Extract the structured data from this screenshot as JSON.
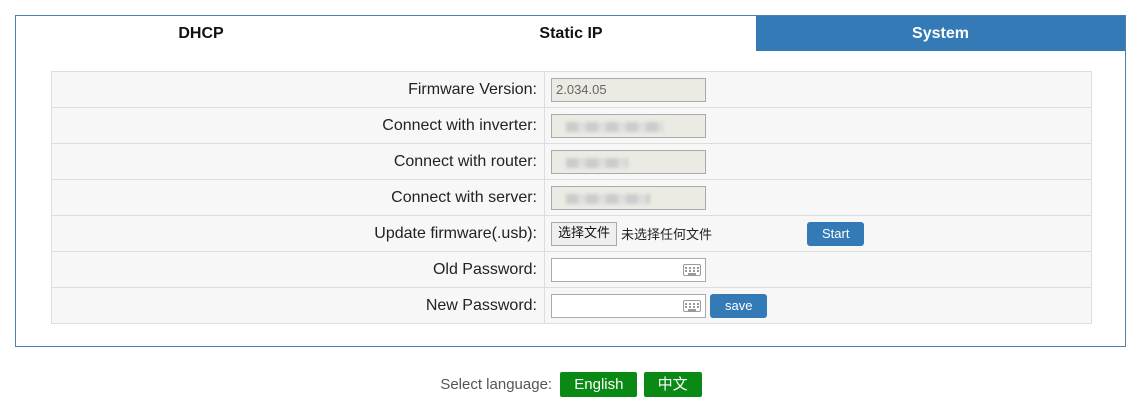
{
  "tabs": [
    {
      "label": "DHCP",
      "active": false
    },
    {
      "label": "Static IP",
      "active": false
    },
    {
      "label": "System",
      "active": true
    }
  ],
  "form": {
    "firmware_version_label": "Firmware Version:",
    "firmware_version_value": "2.034.05",
    "inverter_label": "Connect with inverter:",
    "router_label": "Connect with router:",
    "server_label": "Connect with server:",
    "update_label": "Update firmware(.usb):",
    "choose_file_label": "选择文件",
    "no_file_text": "未选择任何文件",
    "start_label": "Start",
    "old_password_label": "Old Password:",
    "new_password_label": "New Password:",
    "save_label": "save"
  },
  "language": {
    "label": "Select language:",
    "english": "English",
    "chinese": "中文"
  },
  "colors": {
    "active_tab": "#337ab7",
    "primary_button": "#337ab7",
    "language_button": "#0a8a14"
  }
}
